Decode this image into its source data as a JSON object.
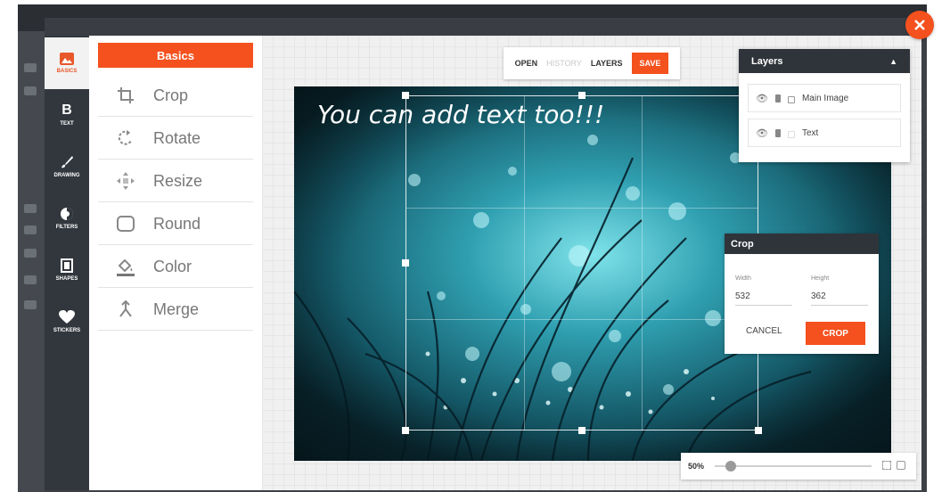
{
  "colors": {
    "accent": "#f4511e",
    "dark": "#2f343a",
    "rail": "#32373d"
  },
  "close": {
    "icon": "close-icon"
  },
  "nav": {
    "items": [
      {
        "label": "BASICS",
        "icon": "image-icon"
      },
      {
        "label": "TEXT",
        "icon": "bold-text-icon"
      },
      {
        "label": "DRAWING",
        "icon": "brush-icon"
      },
      {
        "label": "FILTERS",
        "icon": "filter-icon"
      },
      {
        "label": "SHAPES",
        "icon": "shape-icon"
      },
      {
        "label": "STICKERS",
        "icon": "heart-icon"
      }
    ]
  },
  "panel": {
    "title": "Basics",
    "items": [
      {
        "label": "Crop",
        "icon": "crop-icon"
      },
      {
        "label": "Rotate",
        "icon": "rotate-icon"
      },
      {
        "label": "Resize",
        "icon": "resize-icon"
      },
      {
        "label": "Round",
        "icon": "round-corners-icon"
      },
      {
        "label": "Color",
        "icon": "paint-bucket-icon"
      },
      {
        "label": "Merge",
        "icon": "merge-icon"
      }
    ]
  },
  "toolbar": {
    "open": "OPEN",
    "history": "HISTORY",
    "layers": "LAYERS",
    "save": "SAVE"
  },
  "canvas": {
    "overlay_text": "You can add text too!!!"
  },
  "layers": {
    "title": "Layers",
    "items": [
      {
        "name": "Main Image"
      },
      {
        "name": "Text"
      }
    ]
  },
  "crop": {
    "title": "Crop",
    "width_label": "Width",
    "height_label": "Height",
    "width_value": "532",
    "height_value": "362",
    "cancel": "CANCEL",
    "confirm": "CROP"
  },
  "zoom": {
    "label": "50%",
    "level": 0.1
  }
}
